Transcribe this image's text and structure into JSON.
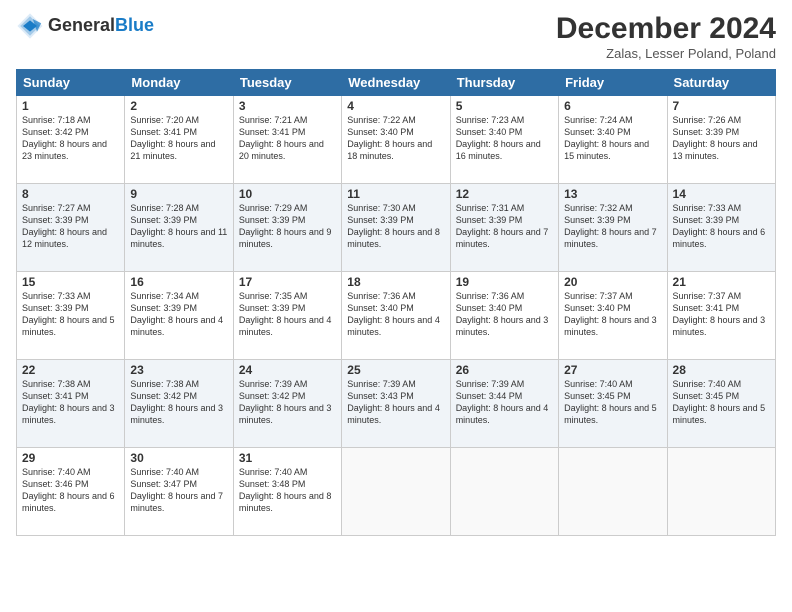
{
  "header": {
    "logo_general": "General",
    "logo_blue": "Blue",
    "month_title": "December 2024",
    "location": "Zalas, Lesser Poland, Poland"
  },
  "weekdays": [
    "Sunday",
    "Monday",
    "Tuesday",
    "Wednesday",
    "Thursday",
    "Friday",
    "Saturday"
  ],
  "weeks": [
    [
      {
        "day": "1",
        "sunrise": "Sunrise: 7:18 AM",
        "sunset": "Sunset: 3:42 PM",
        "daylight": "Daylight: 8 hours and 23 minutes."
      },
      {
        "day": "2",
        "sunrise": "Sunrise: 7:20 AM",
        "sunset": "Sunset: 3:41 PM",
        "daylight": "Daylight: 8 hours and 21 minutes."
      },
      {
        "day": "3",
        "sunrise": "Sunrise: 7:21 AM",
        "sunset": "Sunset: 3:41 PM",
        "daylight": "Daylight: 8 hours and 20 minutes."
      },
      {
        "day": "4",
        "sunrise": "Sunrise: 7:22 AM",
        "sunset": "Sunset: 3:40 PM",
        "daylight": "Daylight: 8 hours and 18 minutes."
      },
      {
        "day": "5",
        "sunrise": "Sunrise: 7:23 AM",
        "sunset": "Sunset: 3:40 PM",
        "daylight": "Daylight: 8 hours and 16 minutes."
      },
      {
        "day": "6",
        "sunrise": "Sunrise: 7:24 AM",
        "sunset": "Sunset: 3:40 PM",
        "daylight": "Daylight: 8 hours and 15 minutes."
      },
      {
        "day": "7",
        "sunrise": "Sunrise: 7:26 AM",
        "sunset": "Sunset: 3:39 PM",
        "daylight": "Daylight: 8 hours and 13 minutes."
      }
    ],
    [
      {
        "day": "8",
        "sunrise": "Sunrise: 7:27 AM",
        "sunset": "Sunset: 3:39 PM",
        "daylight": "Daylight: 8 hours and 12 minutes."
      },
      {
        "day": "9",
        "sunrise": "Sunrise: 7:28 AM",
        "sunset": "Sunset: 3:39 PM",
        "daylight": "Daylight: 8 hours and 11 minutes."
      },
      {
        "day": "10",
        "sunrise": "Sunrise: 7:29 AM",
        "sunset": "Sunset: 3:39 PM",
        "daylight": "Daylight: 8 hours and 9 minutes."
      },
      {
        "day": "11",
        "sunrise": "Sunrise: 7:30 AM",
        "sunset": "Sunset: 3:39 PM",
        "daylight": "Daylight: 8 hours and 8 minutes."
      },
      {
        "day": "12",
        "sunrise": "Sunrise: 7:31 AM",
        "sunset": "Sunset: 3:39 PM",
        "daylight": "Daylight: 8 hours and 7 minutes."
      },
      {
        "day": "13",
        "sunrise": "Sunrise: 7:32 AM",
        "sunset": "Sunset: 3:39 PM",
        "daylight": "Daylight: 8 hours and 7 minutes."
      },
      {
        "day": "14",
        "sunrise": "Sunrise: 7:33 AM",
        "sunset": "Sunset: 3:39 PM",
        "daylight": "Daylight: 8 hours and 6 minutes."
      }
    ],
    [
      {
        "day": "15",
        "sunrise": "Sunrise: 7:33 AM",
        "sunset": "Sunset: 3:39 PM",
        "daylight": "Daylight: 8 hours and 5 minutes."
      },
      {
        "day": "16",
        "sunrise": "Sunrise: 7:34 AM",
        "sunset": "Sunset: 3:39 PM",
        "daylight": "Daylight: 8 hours and 4 minutes."
      },
      {
        "day": "17",
        "sunrise": "Sunrise: 7:35 AM",
        "sunset": "Sunset: 3:39 PM",
        "daylight": "Daylight: 8 hours and 4 minutes."
      },
      {
        "day": "18",
        "sunrise": "Sunrise: 7:36 AM",
        "sunset": "Sunset: 3:40 PM",
        "daylight": "Daylight: 8 hours and 4 minutes."
      },
      {
        "day": "19",
        "sunrise": "Sunrise: 7:36 AM",
        "sunset": "Sunset: 3:40 PM",
        "daylight": "Daylight: 8 hours and 3 minutes."
      },
      {
        "day": "20",
        "sunrise": "Sunrise: 7:37 AM",
        "sunset": "Sunset: 3:40 PM",
        "daylight": "Daylight: 8 hours and 3 minutes."
      },
      {
        "day": "21",
        "sunrise": "Sunrise: 7:37 AM",
        "sunset": "Sunset: 3:41 PM",
        "daylight": "Daylight: 8 hours and 3 minutes."
      }
    ],
    [
      {
        "day": "22",
        "sunrise": "Sunrise: 7:38 AM",
        "sunset": "Sunset: 3:41 PM",
        "daylight": "Daylight: 8 hours and 3 minutes."
      },
      {
        "day": "23",
        "sunrise": "Sunrise: 7:38 AM",
        "sunset": "Sunset: 3:42 PM",
        "daylight": "Daylight: 8 hours and 3 minutes."
      },
      {
        "day": "24",
        "sunrise": "Sunrise: 7:39 AM",
        "sunset": "Sunset: 3:42 PM",
        "daylight": "Daylight: 8 hours and 3 minutes."
      },
      {
        "day": "25",
        "sunrise": "Sunrise: 7:39 AM",
        "sunset": "Sunset: 3:43 PM",
        "daylight": "Daylight: 8 hours and 4 minutes."
      },
      {
        "day": "26",
        "sunrise": "Sunrise: 7:39 AM",
        "sunset": "Sunset: 3:44 PM",
        "daylight": "Daylight: 8 hours and 4 minutes."
      },
      {
        "day": "27",
        "sunrise": "Sunrise: 7:40 AM",
        "sunset": "Sunset: 3:45 PM",
        "daylight": "Daylight: 8 hours and 5 minutes."
      },
      {
        "day": "28",
        "sunrise": "Sunrise: 7:40 AM",
        "sunset": "Sunset: 3:45 PM",
        "daylight": "Daylight: 8 hours and 5 minutes."
      }
    ],
    [
      {
        "day": "29",
        "sunrise": "Sunrise: 7:40 AM",
        "sunset": "Sunset: 3:46 PM",
        "daylight": "Daylight: 8 hours and 6 minutes."
      },
      {
        "day": "30",
        "sunrise": "Sunrise: 7:40 AM",
        "sunset": "Sunset: 3:47 PM",
        "daylight": "Daylight: 8 hours and 7 minutes."
      },
      {
        "day": "31",
        "sunrise": "Sunrise: 7:40 AM",
        "sunset": "Sunset: 3:48 PM",
        "daylight": "Daylight: 8 hours and 8 minutes."
      },
      null,
      null,
      null,
      null
    ]
  ]
}
